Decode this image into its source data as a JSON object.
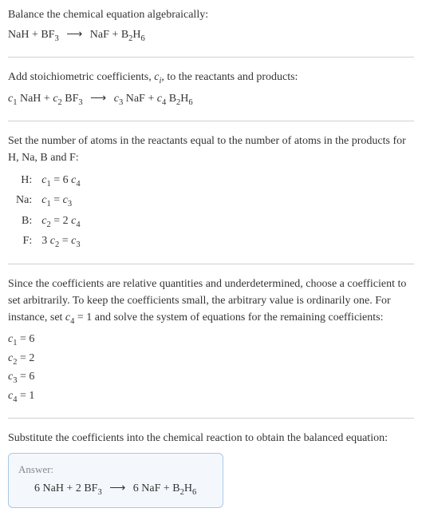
{
  "intro": {
    "line1": "Balance the chemical equation algebraically:"
  },
  "eq1": {
    "NaH": "NaH",
    "plus": " + ",
    "BF": "BF",
    "BF_sub": "3",
    "arrow": "⟶",
    "NaF": "NaF",
    "B": "B",
    "B_sub1": "2",
    "H": "H",
    "H_sub": "6"
  },
  "stoich": {
    "text": "Add stoichiometric coefficients, ",
    "ci": "c",
    "ci_sub": "i",
    "text2": ", to the reactants and products:"
  },
  "eq2": {
    "c1": "c",
    "c1_sub": "1",
    "sp1": " NaH + ",
    "c2": "c",
    "c2_sub": "2",
    "sp2": " BF",
    "bf_sub": "3",
    "arrow": "⟶",
    "c3": "c",
    "c3_sub": "3",
    "sp3": " NaF + ",
    "c4": "c",
    "c4_sub": "4",
    "sp4": " B",
    "b_sub": "2",
    "h": "H",
    "h_sub": "6"
  },
  "atoms_intro": "Set the number of atoms in the reactants equal to the number of atoms in the products for H, Na, B and F:",
  "atoms": {
    "r1_el": "H:",
    "r1_eq_a": "c",
    "r1_eq_as": "1",
    "r1_eq_mid": " = 6 ",
    "r1_eq_b": "c",
    "r1_eq_bs": "4",
    "r2_el": "Na:",
    "r2_eq_a": "c",
    "r2_eq_as": "1",
    "r2_eq_mid": " = ",
    "r2_eq_b": "c",
    "r2_eq_bs": "3",
    "r3_el": "B:",
    "r3_eq_a": "c",
    "r3_eq_as": "2",
    "r3_eq_mid": " = 2 ",
    "r3_eq_b": "c",
    "r3_eq_bs": "4",
    "r4_el": "F:",
    "r4_pre": "3 ",
    "r4_eq_a": "c",
    "r4_eq_as": "2",
    "r4_eq_mid": " = ",
    "r4_eq_b": "c",
    "r4_eq_bs": "3"
  },
  "underdet": {
    "text1": "Since the coefficients are relative quantities and underdetermined, choose a coefficient to set arbitrarily. To keep the coefficients small, the arbitrary value is ordinarily one. For instance, set ",
    "c4": "c",
    "c4_sub": "4",
    "text2": " = 1 and solve the system of equations for the remaining coefficients:"
  },
  "coefs": {
    "c1": "c",
    "c1s": "1",
    "c1v": " = 6",
    "c2": "c",
    "c2s": "2",
    "c2v": " = 2",
    "c3": "c",
    "c3s": "3",
    "c3v": " = 6",
    "c4": "c",
    "c4s": "4",
    "c4v": " = 1"
  },
  "subst": "Substitute the coefficients into the chemical reaction to obtain the balanced equation:",
  "answer": {
    "label": "Answer:",
    "pre1": "6 NaH + 2 BF",
    "bf_sub": "3",
    "arrow": "⟶",
    "mid": "6 NaF + B",
    "b_sub": "2",
    "h": "H",
    "h_sub": "6"
  }
}
